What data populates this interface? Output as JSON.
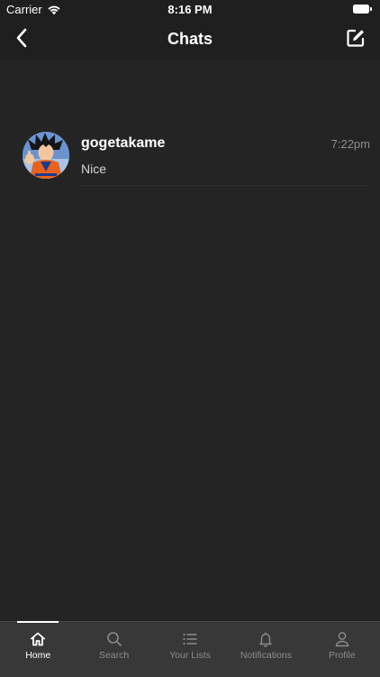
{
  "status_bar": {
    "carrier": "Carrier",
    "time": "8:16 PM"
  },
  "nav": {
    "title": "Chats",
    "back_icon": "chevron-left-icon",
    "compose_icon": "compose-icon"
  },
  "chats": [
    {
      "name": "gogetakame",
      "time": "7:22pm",
      "preview": "Nice",
      "avatar": "avatar-image"
    }
  ],
  "tabs": [
    {
      "label": "Home",
      "icon": "home-icon",
      "active": true
    },
    {
      "label": "Search",
      "icon": "search-icon",
      "active": false
    },
    {
      "label": "Your Lists",
      "icon": "list-icon",
      "active": false
    },
    {
      "label": "Notifications",
      "icon": "bell-icon",
      "active": false
    },
    {
      "label": "Profile",
      "icon": "person-icon",
      "active": false
    }
  ],
  "colors": {
    "background": "#242424",
    "bars": "#1f1f1f",
    "tab_bar": "#383838",
    "active": "#ffffff",
    "inactive": "#8c8c8c",
    "secondary_text": "#8e8e8e"
  }
}
